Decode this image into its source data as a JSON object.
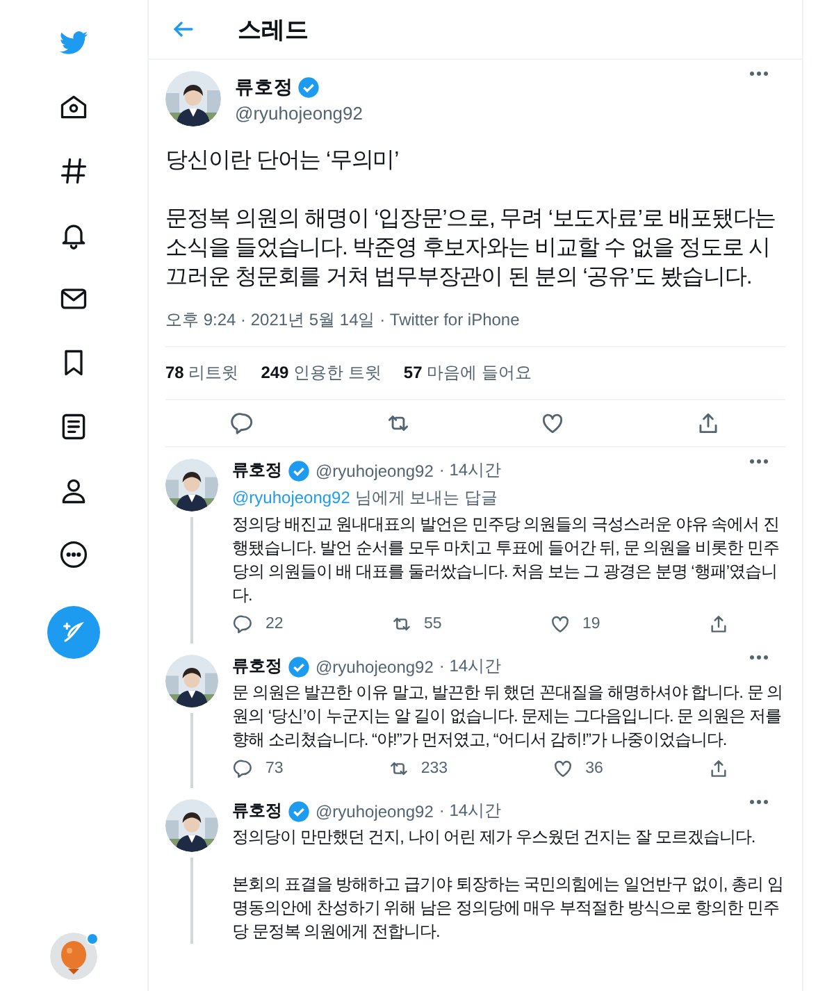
{
  "sidebar": {
    "items": [
      {
        "kind": "logo"
      },
      {
        "kind": "home"
      },
      {
        "kind": "hash"
      },
      {
        "kind": "bell"
      },
      {
        "kind": "mail"
      },
      {
        "kind": "bookmark"
      },
      {
        "kind": "list"
      },
      {
        "kind": "person"
      },
      {
        "kind": "more"
      }
    ],
    "compose": {
      "kind": "compose"
    },
    "account": {
      "notification_dot": true
    }
  },
  "header": {
    "title": "스레드"
  },
  "main_tweet": {
    "name": "류호정",
    "verified": true,
    "handle": "@ryuhojeong92",
    "paragraphs": [
      "당신이란 단어는 ‘무의미’",
      "문정복 의원의 해명이 ‘입장문’으로, 무려 ‘보도자료’로 배포됐다는 소식을 들었습니다. 박준영 후보자와는 비교할 수 없을 정도로 시끄러운 청문회를 거쳐 법무부장관이 된 분의 ‘공유’도 봤습니다."
    ],
    "meta": "오후 9:24 · 2021년 5월 14일 · Twitter for iPhone",
    "stats": [
      {
        "count": "78",
        "label": "리트윗"
      },
      {
        "count": "249",
        "label": "인용한 트윗"
      },
      {
        "count": "57",
        "label": "마음에 들어요"
      }
    ]
  },
  "replies": [
    {
      "name": "류호정",
      "verified": true,
      "handle": "@ryuhojeong92",
      "time": "· 14시간",
      "thread_line": true,
      "reply_to": {
        "handle": "@ryuhojeong92",
        "text": "님에게 보내는 답글"
      },
      "paragraphs": [
        "정의당 배진교 원내대표의 발언은 민주당 의원들의 극성스러운 야유 속에서 진행됐습니다. 발언 순서를 모두 마치고 투표에 들어간 뒤, 문 의원을 비롯한 민주당의 의원들이 배 대표를 둘러쌌습니다. 처음 보는 그 광경은 분명 ‘행패’였습니다."
      ],
      "counts": {
        "reply": "22",
        "retweet": "55",
        "like": "19"
      }
    },
    {
      "name": "류호정",
      "verified": true,
      "handle": "@ryuhojeong92",
      "time": "· 14시간",
      "thread_line": true,
      "paragraphs": [
        "문 의원은 발끈한 이유 말고, 발끈한 뒤 했던 꼰대질을 해명하셔야 합니다. 문 의원의 ‘당신’이 누군지는 알 길이 없습니다. 문제는 그다음입니다. 문 의원은 저를 향해 소리쳤습니다. “야!”가 먼저였고, “어디서 감히!”가 나중이었습니다."
      ],
      "counts": {
        "reply": "73",
        "retweet": "233",
        "like": "36"
      }
    },
    {
      "name": "류호정",
      "verified": true,
      "handle": "@ryuhojeong92",
      "time": "· 14시간",
      "thread_line": true,
      "paragraphs": [
        "정의당이 만만했던 건지, 나이 어린 제가 우스웠던 건지는 잘 모르겠습니다.",
        "본회의 표결을 방해하고 급기야 퇴장하는 국민의힘에는 일언반구 없이, 총리 임명동의안에 찬성하기 위해 남은 정의당에 매우 부적절한 방식으로 항의한 민주당 문정복 의원에게 전합니다."
      ]
    }
  ]
}
